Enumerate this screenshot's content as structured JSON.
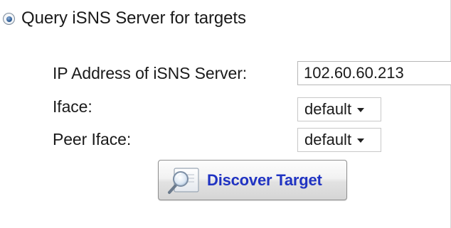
{
  "option": {
    "label": "Query iSNS Server for targets",
    "selected": true
  },
  "form": {
    "ip_label": "IP Address of iSNS Server:",
    "ip_value": "102.60.60.213",
    "iface_label": "Iface:",
    "iface_value": "default",
    "peer_iface_label": "Peer Iface:",
    "peer_iface_value": "default"
  },
  "actions": {
    "discover_label": "Discover Target",
    "discover_icon": "magnifier-icon"
  },
  "colors": {
    "button_text": "#2033c2",
    "radio_fill": "#2f5e96"
  }
}
